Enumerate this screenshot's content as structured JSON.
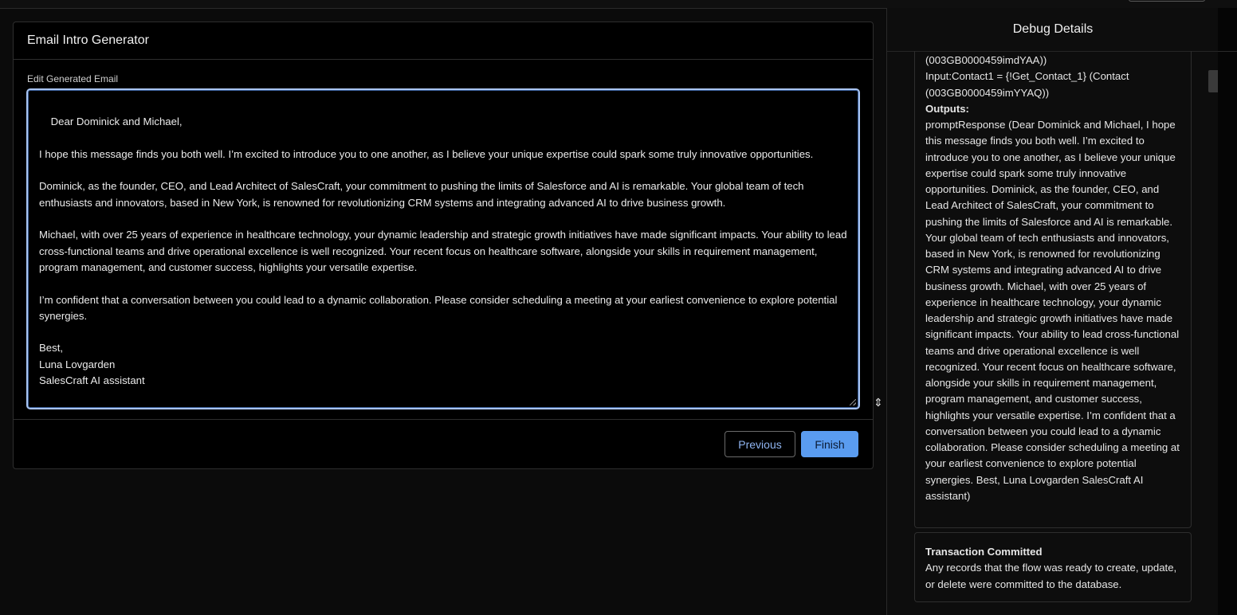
{
  "card": {
    "title": "Email Intro Generator",
    "field_label": "Edit Generated Email",
    "email_body": "Dear Dominick and Michael,\n\nI hope this message finds you both well. I’m excited to introduce you to one another, as I believe your unique expertise could spark some truly innovative opportunities.\n\nDominick, as the founder, CEO, and Lead Architect of SalesCraft, your commitment to pushing the limits of Salesforce and AI is remarkable. Your global team of tech enthusiasts and innovators, based in New York, is renowned for revolutionizing CRM systems and integrating advanced AI to drive business growth.\n\nMichael, with over 25 years of experience in healthcare technology, your dynamic leadership and strategic growth initiatives have made significant impacts. Your ability to lead cross-functional teams and drive operational excellence is well recognized. Your recent focus on healthcare software, alongside your skills in requirement management, program management, and customer success, highlights your versatile expertise.\n\nI’m confident that a conversation between you could lead to a dynamic collaboration. Please consider scheduling a meeting at your earliest convenience to explore potential synergies.\n\nBest,\nLuna Lovgarden\nSalesCraft AI assistant",
    "previous_label": "Previous",
    "finish_label": "Finish"
  },
  "debug": {
    "title": "Debug Details",
    "input_line_1": "(003GB0000459imdYAA))",
    "input_line_2": "Input:Contact1 = {!Get_Contact_1} (Contact",
    "input_line_3": "(003GB0000459imYYAQ))",
    "outputs_label": "Outputs:",
    "prompt_response": "promptResponse (Dear Dominick and Michael, I hope this message finds you both well. I’m excited to introduce you to one another, as I believe your unique expertise could spark some truly innovative opportunities. Dominick, as the founder, CEO, and Lead Architect of SalesCraft, your commitment to pushing the limits of Salesforce and AI is remarkable. Your global team of tech enthusiasts and innovators, based in New York, is renowned for revolutionizing CRM systems and integrating advanced AI to drive business growth. Michael, with over 25 years of experience in healthcare technology, your dynamic leadership and strategic growth initiatives have made significant impacts. Your ability to lead cross-functional teams and drive operational excellence is well recognized. Your recent focus on healthcare software, alongside your skills in requirement management, program management, and customer success, highlights your versatile expertise. I’m confident that a conversation between you could lead to a dynamic collaboration. Please consider scheduling a meeting at your earliest convenience to explore potential synergies. Best, Luna Lovgarden SalesCraft AI assistant)",
    "commit_title": "Transaction Committed",
    "commit_text": "Any records that the flow was ready to create, update, or delete were committed to the database."
  },
  "icons": {
    "cursor": "resize-vertical-cursor-icon"
  },
  "colors": {
    "accent": "#5a9cf0",
    "focus_border": "#a9c4f0",
    "background": "#000000"
  }
}
